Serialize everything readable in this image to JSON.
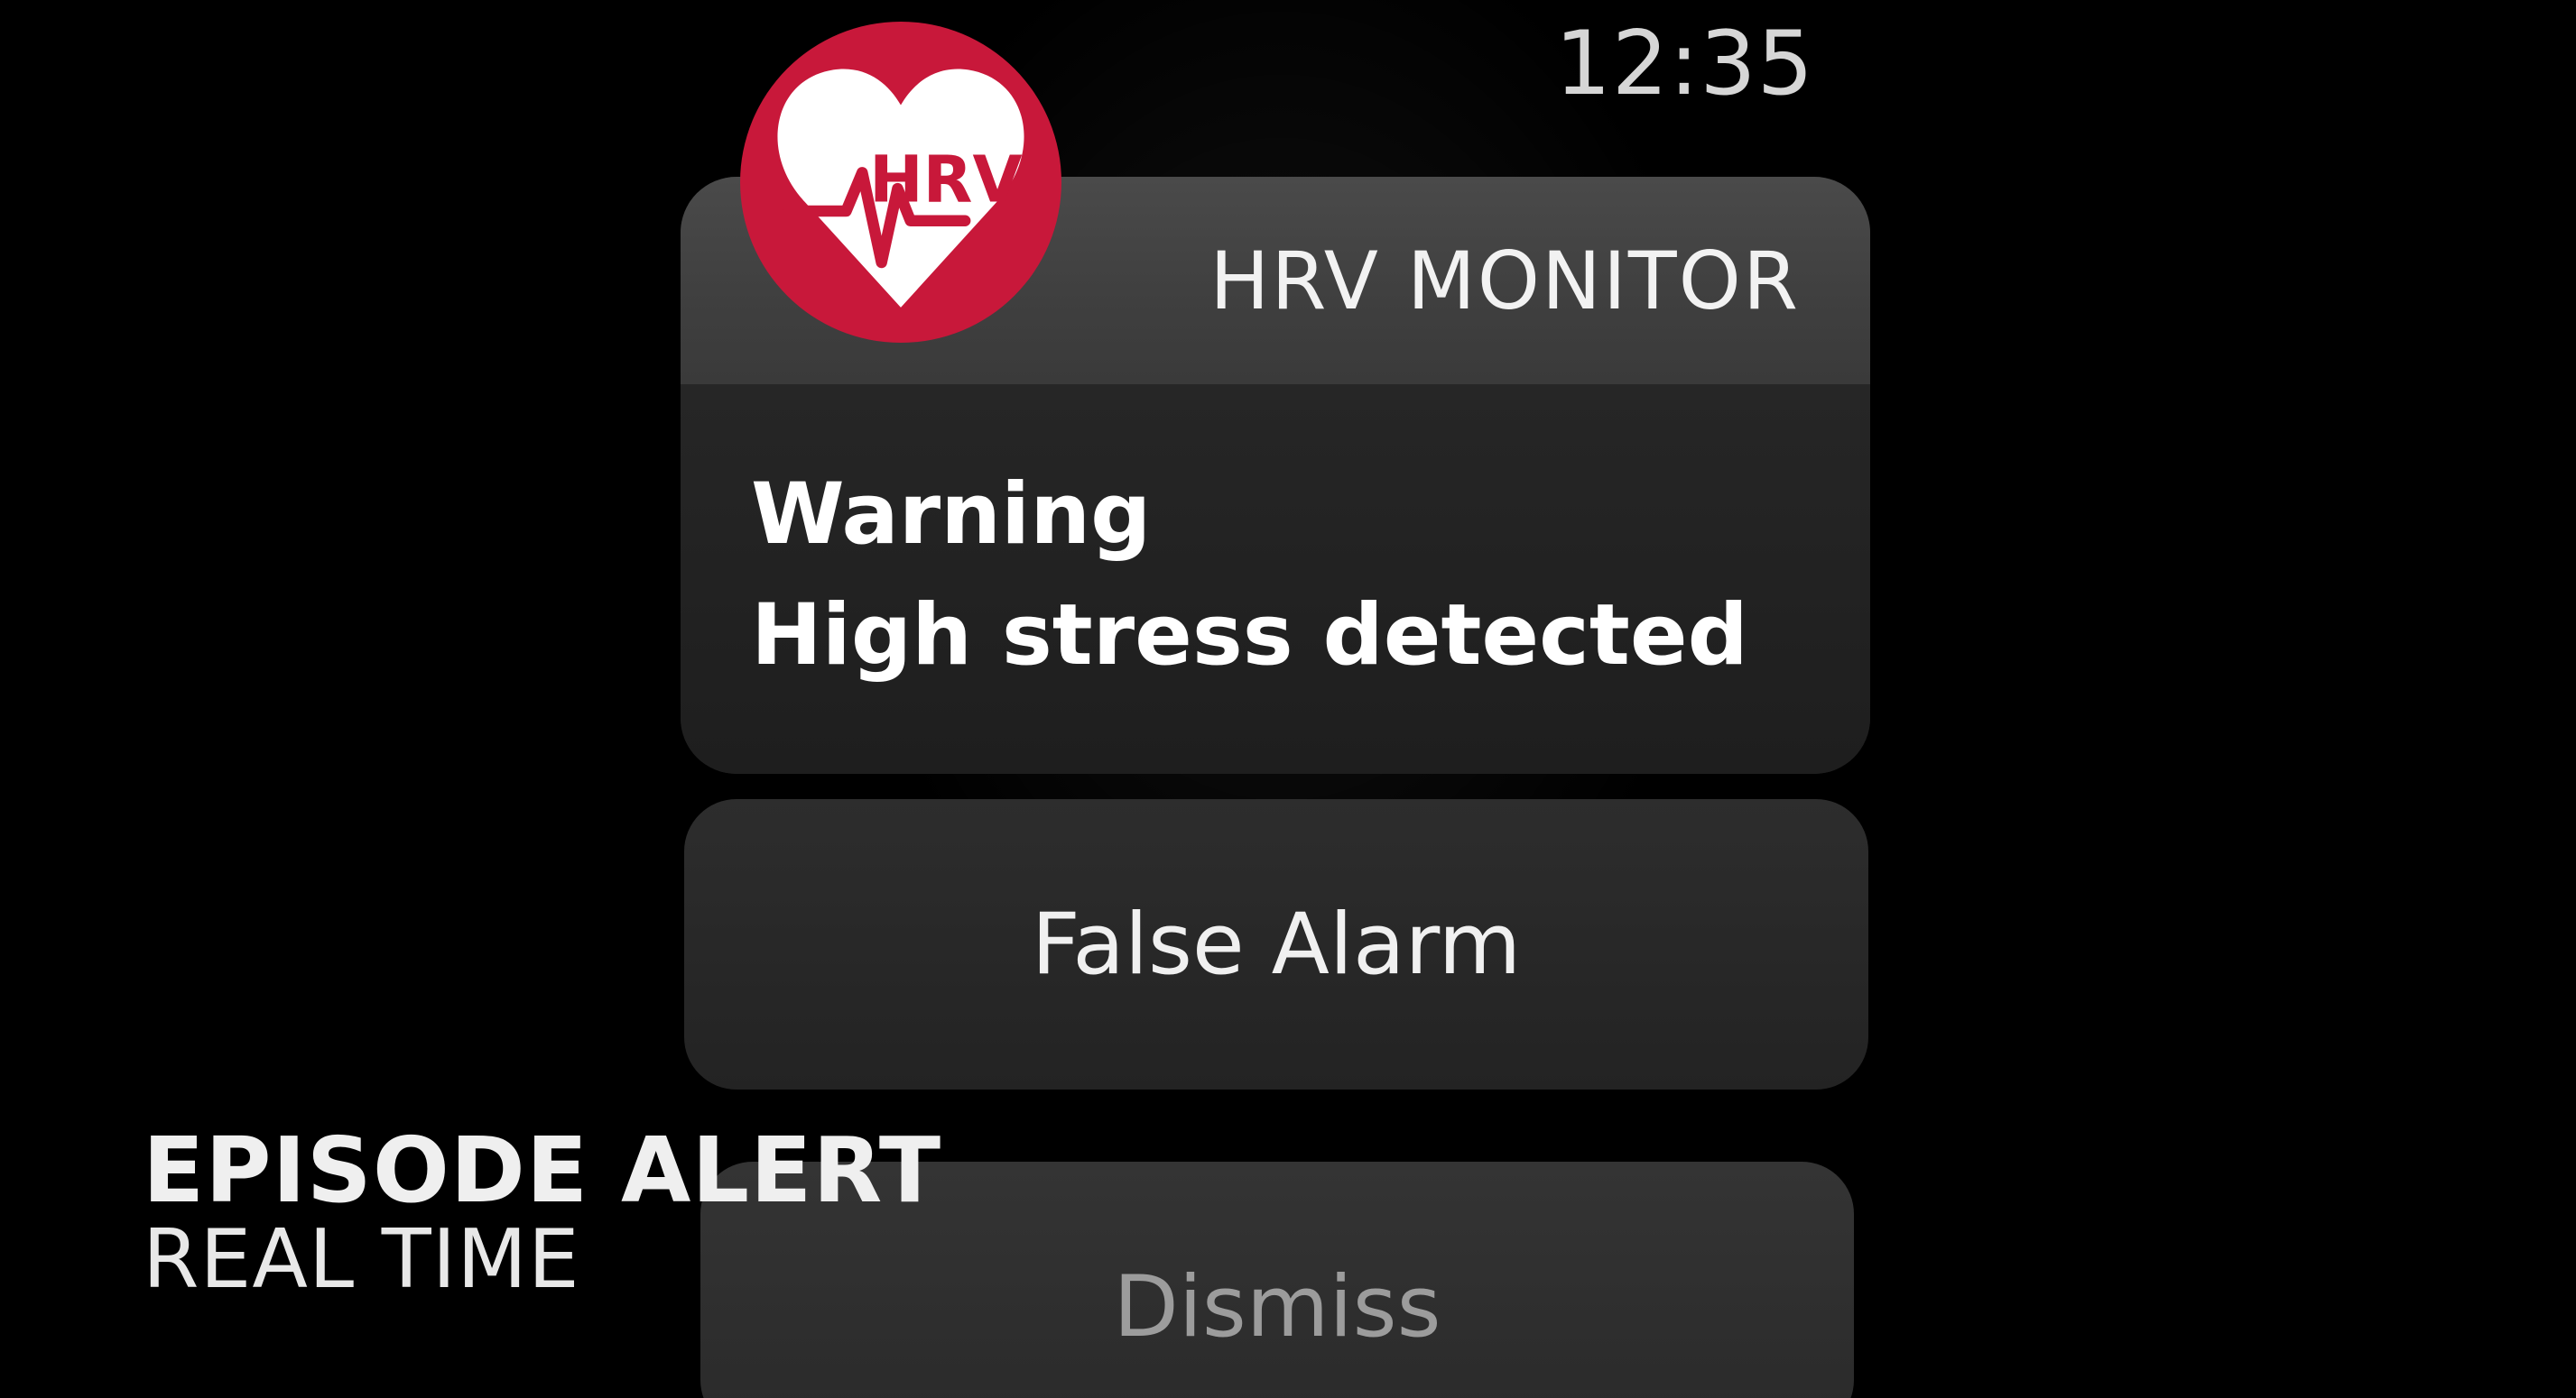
{
  "status_bar": {
    "time": "12:35"
  },
  "notification": {
    "app_icon": {
      "name": "hrv-heart-icon",
      "label": "HRV",
      "brand_color": "#c8183a"
    },
    "app_name": "HRV MONITOR",
    "title": "Warning",
    "message": "High stress detected"
  },
  "actions": {
    "false_alarm_label": "False Alarm",
    "dismiss_label": "Dismiss"
  },
  "caption": {
    "line1": "EPISODE ALERT",
    "line2": "REAL TIME"
  }
}
